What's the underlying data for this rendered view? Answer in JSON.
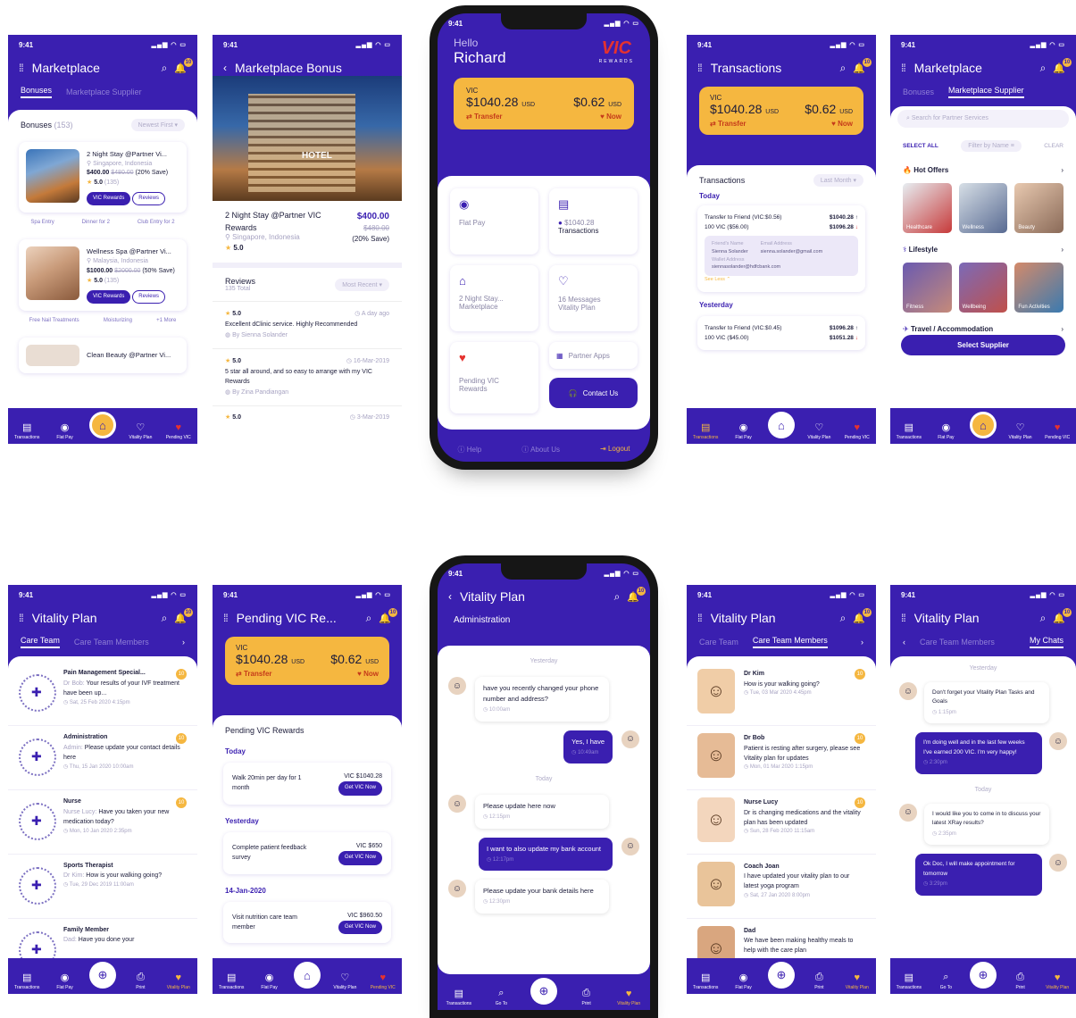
{
  "colors": {
    "brand": "#3a1fb0",
    "accent": "#f5b740",
    "alert": "#e5322f"
  },
  "status_time": "9:41",
  "icons": {
    "menu": "grid-menu-icon",
    "search": "search-icon",
    "bell": "bell-icon",
    "back": "back-arrow-icon",
    "notification_count": "10"
  },
  "nav_main": [
    "Transactions",
    "Flat Pay",
    "",
    "Vitality Plan",
    "Pending VIC"
  ],
  "nav_care": [
    "Transactions",
    "Flat Pay",
    "",
    "Print",
    "Vitality Plan"
  ],
  "nav_chat": [
    "Transactions",
    "Go To",
    "",
    "Print",
    "Vitality Plan"
  ],
  "s1": {
    "title": "Marketplace",
    "tab1": "Bonuses",
    "tab2": "Marketplace Supplier",
    "list_title": "Bonuses",
    "list_count": "(153)",
    "sort": "Newest First",
    "items": [
      {
        "name": "2 Night Stay @Partner Vi...",
        "loc": "Singapore, Indonesia",
        "price": "$400.00",
        "old": "$480.00",
        "save": "(20% Save)",
        "rating": "5.0",
        "count": "(135)",
        "btn1": "VIC Rewards",
        "btn2": "Reviews",
        "tags": [
          "Spa Entry",
          "Dinner for 2",
          "Club Entry for 2"
        ]
      },
      {
        "name": "Wellness Spa @Partner Vi...",
        "loc": "Malaysia, Indonesia",
        "price": "$1000.00",
        "old": "$2000.00",
        "save": "(50% Save)",
        "rating": "5.0",
        "count": "(135)",
        "btn1": "VIC Rewards",
        "btn2": "Reviews",
        "tags": [
          "Free Nail Treatments",
          "Moisturizing",
          "+1 More"
        ]
      },
      {
        "name": "Clean Beauty @Partner Vi..."
      }
    ]
  },
  "s2": {
    "title": "Marketplace Bonus",
    "name": "2 Night Stay @Partner VIC Rewards",
    "price": "$400.00",
    "old": "$480.00",
    "save": "(20% Save)",
    "loc": "Singapore, Indonesia",
    "rating": "5.0",
    "hotel_sign": "HOTEL",
    "reviews_title": "Reviews",
    "reviews_total": "135 Total",
    "sort": "Most Recent",
    "reviews": [
      {
        "rating": "5.0",
        "ago": "A day ago",
        "text": "Excellent dClinic service. Highly Recommended",
        "by": "By Sienna Solander"
      },
      {
        "rating": "5.0",
        "ago": "16-Mar-2019",
        "text": "5 star all around, and so easy to arrange with my VIC Rewards",
        "by": "By Zina Pandiangan"
      },
      {
        "rating": "5.0",
        "ago": "3-Mar-2019"
      }
    ]
  },
  "s3": {
    "hello": "Hello",
    "name": "Richard",
    "logo": "VIC",
    "logo_sub": "REWARDS",
    "vic": "VIC",
    "amount": "$1040.28",
    "usd": "USD",
    "amount2": "$0.62",
    "transfer": "Transfer",
    "now": "Now",
    "tiles": [
      {
        "l1": "",
        "l2": "Flat Pay"
      },
      {
        "l1": "$1040.28",
        "l2": "Transactions"
      },
      {
        "l1": "2 Night Stay...",
        "l2": "Marketplace"
      },
      {
        "l1": "16 Messages",
        "l2": "Vitality Plan"
      },
      {
        "l1": "Pending VIC",
        "l2": "Rewards"
      },
      {
        "l1": "",
        "l2": "Partner Apps"
      }
    ],
    "contact": "Contact Us",
    "help": "Help",
    "about": "About Us",
    "logout": "Logout"
  },
  "s4": {
    "title": "Transactions",
    "vic": "VIC",
    "amount": "$1040.28",
    "usd": "USD",
    "amount2": "$0.62",
    "transfer": "Transfer",
    "now": "Now",
    "list_title": "Transactions",
    "filter": "Last Month",
    "today": "Today",
    "yesterday": "Yesterday",
    "t1": {
      "desc": "Transfer to Friend (VIC:$0.56)",
      "sub": "100 VIC ($56.00)",
      "a1": "$1040.28",
      "a2": "$1096.28",
      "fn_l": "Friend's Name",
      "fn": "Sienna Solander",
      "em_l": "Email Address",
      "em": "sienna.solander@gmail.com",
      "wa_l": "Wallet Address",
      "wa": "siennasolander@hdfcbank.com",
      "less": "See Less"
    },
    "t2": {
      "desc": "Transfer to Friend (VIC:$0.45)",
      "sub": "100 VIC ($45.00)",
      "a1": "$1096.28",
      "a2": "$1051.28"
    }
  },
  "s5": {
    "title": "Marketplace",
    "tab1": "Bonuses",
    "tab2": "Marketplace Supplier",
    "search": "Search for Partner Services",
    "select_all": "SELECT ALL",
    "filter": "Filter by Name",
    "clear": "CLEAR",
    "hot": "Hot Offers",
    "hot_tiles": [
      "Healthcare",
      "Wellness",
      "Beauty"
    ],
    "life": "Lifestyle",
    "life_tiles": [
      "Fitness",
      "Wellbeing",
      "Fun Activities"
    ],
    "travel": "Travel / Accommodation",
    "btn": "Select Supplier"
  },
  "s6": {
    "title": "Vitality Plan",
    "tab1": "Care Team",
    "tab2": "Care Team Members",
    "items": [
      {
        "name": "Pain Management Special...",
        "badge": "10",
        "who": "Dr Bob:",
        "msg": "Your results of your IVF treatment have been up...",
        "date": "Sat, 25 Feb 2020 4:15pm"
      },
      {
        "name": "Administration",
        "badge": "10",
        "who": "Admin:",
        "msg": "Please update your contact details here",
        "date": "Thu, 15 Jan 2020 10:00am"
      },
      {
        "name": "Nurse",
        "badge": "10",
        "who": "Nurse Lucy:",
        "msg": "Have you taken your new medication today?",
        "date": "Mon, 10 Jan 2020 2:35pm"
      },
      {
        "name": "Sports Therapist",
        "badge": "",
        "who": "Dr Kim:",
        "msg": "How is your walking going?",
        "date": "Tue, 29 Dec 2019 11:00am"
      },
      {
        "name": "Family Member",
        "badge": "",
        "who": "Dad:",
        "msg": "Have you done your",
        "date": ""
      }
    ]
  },
  "s7": {
    "title": "Pending VIC Re...",
    "vic": "VIC",
    "amount": "$1040.28",
    "usd": "USD",
    "amount2": "$0.62",
    "transfer": "Transfer",
    "now": "Now",
    "section": "Pending VIC Rewards",
    "groups": [
      {
        "label": "Today",
        "desc": "Walk 20min per day for 1 month",
        "val": "VIC $1040.28",
        "btn": "Get VIC Now"
      },
      {
        "label": "Yesterday",
        "desc": "Complete patient feedback survey",
        "val": "VIC $650",
        "btn": "Get VIC Now"
      },
      {
        "label": "14-Jan-2020",
        "desc": "Visit nutrition care team member",
        "val": "VIC $960.50",
        "btn": "Get VIC Now"
      }
    ]
  },
  "s8": {
    "title": "Vitality Plan",
    "section": "Administration",
    "yesterday": "Yesterday",
    "today": "Today",
    "m1": "have you recently changed your phone number and address?",
    "t1": "10:00am",
    "m2": "Yes, I have",
    "t2": "10:49am",
    "m3": "Please update here now",
    "t3": "12:15pm",
    "m4": "I want to also update my bank account",
    "t4": "12:17pm",
    "m5": "Please update your bank details here",
    "t5": "12:30pm"
  },
  "s9": {
    "title": "Vitality Plan",
    "tab1": "Care Team",
    "tab2": "Care Team Members",
    "items": [
      {
        "name": "Dr Kim",
        "badge": "10",
        "msg": "How is your walking going?",
        "date": "Tue, 03 Mar 2020 4:45pm"
      },
      {
        "name": "Dr Bob",
        "badge": "10",
        "msg": "Patient is resting after surgery, please see Vitality plan for updates",
        "date": "Mon, 01 Mar 2020 1:15pm"
      },
      {
        "name": "Nurse Lucy",
        "badge": "10",
        "msg": "Dr is changing medications and the vitality plan has been updated",
        "date": "Sun, 28 Feb 2020 11:15am"
      },
      {
        "name": "Coach Joan",
        "badge": "",
        "msg": "I have updated your vitality plan to our latest yoga program",
        "date": "Sat, 27 Jan 2020 8:00pm"
      },
      {
        "name": "Dad",
        "badge": "",
        "msg": "We have been making healthy meals to help with the care plan",
        "date": ""
      }
    ]
  },
  "s10": {
    "title": "Vitality Plan",
    "tab2": "Care Team Members",
    "tab3": "My Chats",
    "yesterday": "Yesterday",
    "today": "Today",
    "m1": "Don't forget your Vitality Plan Tasks and Goals",
    "t1": "1:15pm",
    "m2": "I'm doing well and in the last few weeks I've earned 200 VIC. I'm very happy!",
    "t2": "2:30pm",
    "m3": "I would like you to come in to discuss your latest XRay results?",
    "t3": "2:35pm",
    "m4": "Ok Doc, I will make appointment for tomorrow",
    "t4": "3:29pm"
  }
}
